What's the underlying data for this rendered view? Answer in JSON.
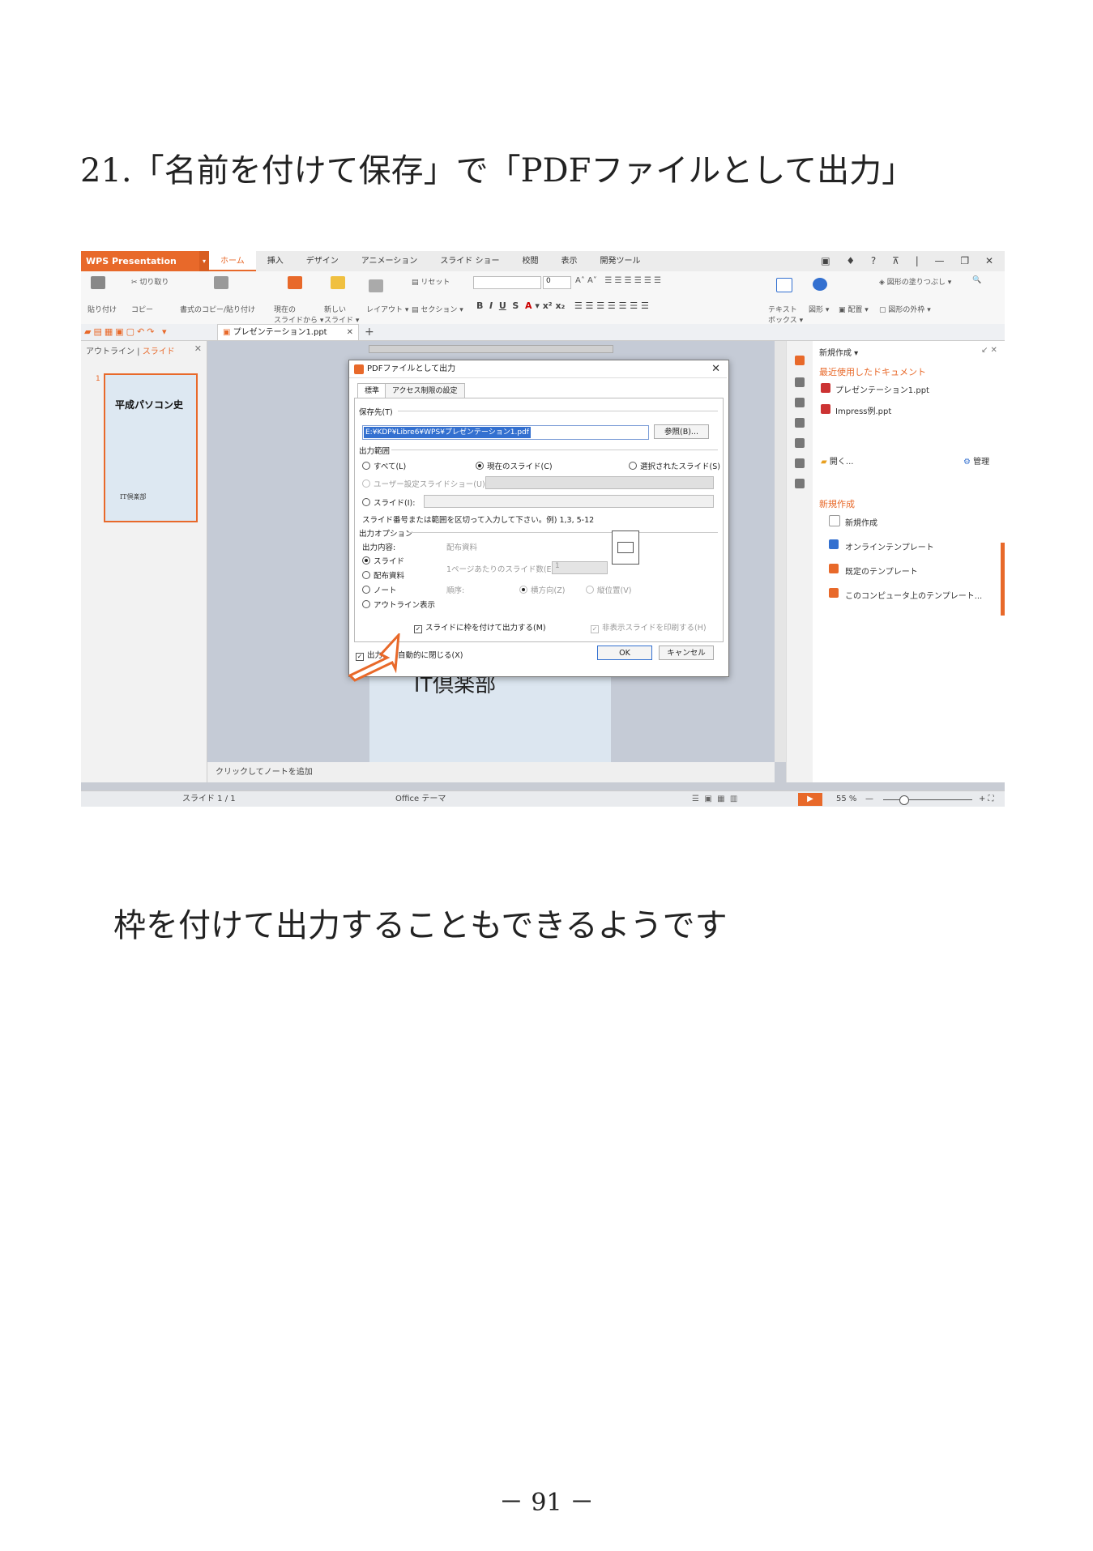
{
  "page": {
    "heading": "21.「名前を付けて保存」で「PDFファイルとして出力」",
    "caption": "枠を付けて出力することもできるようです",
    "page_number": "－ 91 －"
  },
  "app": {
    "name": "WPS Presentation",
    "tabs": [
      "ホーム",
      "挿入",
      "デザイン",
      "アニメーション",
      "スライド ショー",
      "校閲",
      "表示",
      "開発ツール"
    ],
    "active_tab": "ホーム",
    "ribbon": {
      "cut": "切り取り",
      "paste": "貼り付け",
      "copy": "コピー",
      "format_copy": "書式のコピー/貼り付け",
      "from_current": "現在の\nスライドから",
      "new_slide": "新しい\nスライド",
      "layout": "レイアウト",
      "reset": "リセット",
      "section": "セクション",
      "font_size": "0",
      "textbox": "テキスト\nボックス",
      "shape": "図形",
      "arrange": "配置",
      "fill": "図形の塗りつぶし",
      "outline": "図形の外枠"
    },
    "doc_tab": "プレゼンテーション1.ppt",
    "left_pane": {
      "outline": "アウトライン",
      "slide": "スライド",
      "thumb_title": "平成パソコン史",
      "thumb_sub": "IT倶楽部",
      "thumb_num": "1"
    },
    "slide_text": "IT倶楽部",
    "notes": "クリックしてノートを追加",
    "status": {
      "slide": "スライド 1 / 1",
      "theme": "Office テーマ",
      "zoom": "55 %"
    },
    "right_pane": {
      "new": "新規作成",
      "recent_title": "最近使用したドキュメント",
      "recent": [
        "プレゼンテーション1.ppt",
        "Impress例.ppt"
      ],
      "open": "開く...",
      "manage": "管理",
      "new_title": "新規作成",
      "new_items": [
        "新規作成",
        "オンラインテンプレート",
        "既定のテンプレート",
        "このコンピュータ上のテンプレート..."
      ]
    }
  },
  "dialog": {
    "title": "PDFファイルとして出力",
    "tab_standard": "標準",
    "tab_access": "アクセス制限の設定",
    "save_to": "保存先(T)",
    "path": "E:¥KDP¥Libre6¥WPS¥プレゼンテーション1.pdf",
    "browse": "参照(B)...",
    "range": "出力範囲",
    "all": "すべて(L)",
    "current": "現在のスライド(C)",
    "selected": "選択されたスライド(S)",
    "custom_show": "ユーザー設定スライドショー(U)",
    "slides": "スライド(I):",
    "hint": "スライド番号または範囲を区切って入力して下さい。例) 1,3, 5-12",
    "options": "出力オプション",
    "content": "出力内容:",
    "content_items": [
      "スライド",
      "配布資料",
      "ノート",
      "アウトライン表示"
    ],
    "handout": "配布資料",
    "per_page": "1ページあたりのスライド数(E):",
    "per_page_val": "1",
    "order": "順序:",
    "horizontal": "横方向(Z)",
    "vertical": "縦位置(V)",
    "frame": "スライドに枠を付けて出力する(M)",
    "hidden": "非表示スライドを印刷する(H)",
    "auto_close": "出力後に自動的に閉じる(X)",
    "ok": "OK",
    "cancel": "キャンセル"
  },
  "colors": {
    "accent": "#e8692a",
    "selection": "#3370d0"
  }
}
